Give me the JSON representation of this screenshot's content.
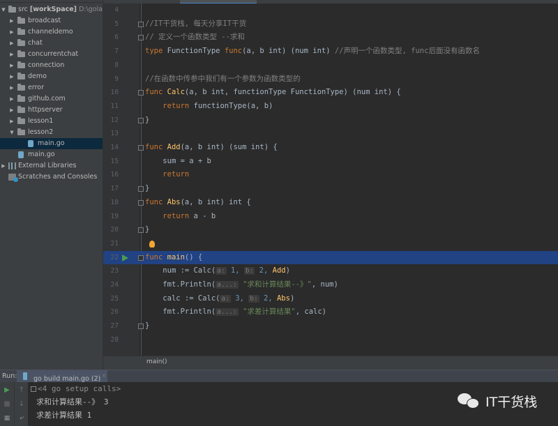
{
  "sidebar": {
    "root": {
      "name": "src",
      "module": "[workSpace]",
      "path": "D:\\goland"
    },
    "items": [
      {
        "label": "broadcast",
        "type": "folder",
        "expanded": false
      },
      {
        "label": "channeldemo",
        "type": "folder",
        "expanded": false
      },
      {
        "label": "chat",
        "type": "folder",
        "expanded": false
      },
      {
        "label": "concurrentchat",
        "type": "folder",
        "expanded": false
      },
      {
        "label": "connection",
        "type": "folder",
        "expanded": false
      },
      {
        "label": "demo",
        "type": "folder",
        "expanded": false
      },
      {
        "label": "error",
        "type": "folder",
        "expanded": false
      },
      {
        "label": "github.com",
        "type": "folder",
        "expanded": false
      },
      {
        "label": "httpserver",
        "type": "folder",
        "expanded": false
      },
      {
        "label": "lesson1",
        "type": "folder",
        "expanded": false
      },
      {
        "label": "lesson2",
        "type": "folder",
        "expanded": true
      },
      {
        "label": "main.go",
        "type": "file",
        "selected": true
      },
      {
        "label": "main.go",
        "type": "file"
      }
    ],
    "external_libraries": "External Libraries",
    "scratches": "Scratches and Consoles"
  },
  "editor": {
    "lines": [
      {
        "n": "4",
        "text": ""
      },
      {
        "n": "5",
        "text": "//IT干货栈, 每天分享IT干货"
      },
      {
        "n": "6",
        "text": "// 定义一个函数类型 --求和"
      },
      {
        "n": "7",
        "kw1": "type",
        "mid1": " FunctionType ",
        "kw2": "func",
        "mid2": "(a, b int) (num int) ",
        "comment": "//声明一个函数类型, func后面没有函数名"
      },
      {
        "n": "8",
        "text": ""
      },
      {
        "n": "9",
        "text": "//在函数中传参中我们有一个参数为函数类型的"
      },
      {
        "n": "10",
        "kw": "func",
        "name": "Calc",
        "rest": "(a, b int, functionType FunctionType) (num int) {"
      },
      {
        "n": "11",
        "kw": "return",
        "rest": " functionType(a, b)"
      },
      {
        "n": "12",
        "text": "}"
      },
      {
        "n": "13",
        "text": ""
      },
      {
        "n": "14",
        "kw": "func",
        "name": "Add",
        "rest": "(a, b int) (sum int) {"
      },
      {
        "n": "15",
        "text": "sum = a + b"
      },
      {
        "n": "16",
        "kw": "return",
        "rest": ""
      },
      {
        "n": "17",
        "text": "}"
      },
      {
        "n": "18",
        "kw": "func",
        "name": "Abs",
        "rest": "(a, b int) int {"
      },
      {
        "n": "19",
        "kw": "return",
        "rest": " a - b"
      },
      {
        "n": "20",
        "text": "}"
      },
      {
        "n": "21",
        "text": ""
      },
      {
        "n": "22",
        "kw": "func",
        "name": "main",
        "rest": "() {"
      },
      {
        "n": "23",
        "pre": "num := Calc(",
        "h1": "a:",
        "v1": " 1, ",
        "h2": "b:",
        "v2": " 2, ",
        "ref": "Add",
        "post": ")"
      },
      {
        "n": "24",
        "pre": "fmt.Println(",
        "h1": "a...:",
        "s": " \"求和计算结果--》\"",
        "post": ", num)"
      },
      {
        "n": "25",
        "pre": "calc := Calc(",
        "h1": "a:",
        "v1": " 3, ",
        "h2": "b:",
        "v2": " 2, ",
        "ref": "Abs",
        "post": ")"
      },
      {
        "n": "26",
        "pre": "fmt.Println(",
        "h1": "a...:",
        "s": " \"求差计算结果\"",
        "post": ", calc)"
      },
      {
        "n": "27",
        "text": "}"
      },
      {
        "n": "28",
        "text": ""
      }
    ],
    "breadcrumb": "main()"
  },
  "run": {
    "label": "Run:",
    "tab": "go build main.go (2)",
    "console": [
      "<4 go setup calls>",
      "求和计算结果--》 3",
      "求差计算结果 1"
    ]
  },
  "watermark": {
    "text": "IT干货栈"
  },
  "colors": {
    "keyword": "#cc7832",
    "function": "#ffc66d",
    "comment": "#808080",
    "caret_line": "#214283",
    "run_icon": "#499c54"
  }
}
